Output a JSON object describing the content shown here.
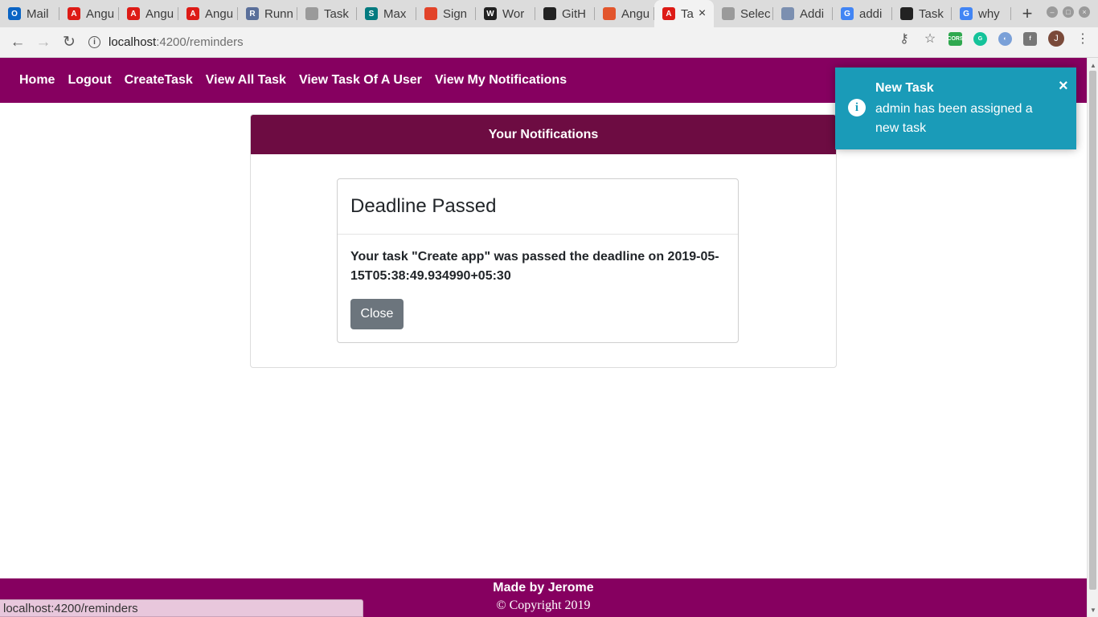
{
  "browser": {
    "tabs": [
      {
        "label": "Mail",
        "icon": "outlook-icon",
        "color": "#0a64c4",
        "glyph": "O"
      },
      {
        "label": "Angu",
        "icon": "angular-icon",
        "color": "#dd1b16",
        "glyph": "A"
      },
      {
        "label": "Angu",
        "icon": "angular-icon",
        "color": "#dd1b16",
        "glyph": "A"
      },
      {
        "label": "Angu",
        "icon": "angular-icon",
        "color": "#dd1b16",
        "glyph": "A"
      },
      {
        "label": "Runn",
        "icon": "runner-icon",
        "color": "#5a6f9a",
        "glyph": "R"
      },
      {
        "label": "Task",
        "icon": "globe-icon",
        "color": "#9a9a9a",
        "glyph": ""
      },
      {
        "label": "Max",
        "icon": "sharepoint-icon",
        "color": "#047b80",
        "glyph": "S"
      },
      {
        "label": "Sign",
        "icon": "gitlab-icon",
        "color": "#e24329",
        "glyph": ""
      },
      {
        "label": "Wor",
        "icon": "wordpress-icon",
        "color": "#222222",
        "glyph": "W"
      },
      {
        "label": "GitH",
        "icon": "github-icon",
        "color": "#222222",
        "glyph": ""
      },
      {
        "label": "Angu",
        "icon": "stackblitz-icon",
        "color": "#e2552c",
        "glyph": ""
      },
      {
        "label": "Ta",
        "icon": "angular-icon",
        "color": "#dd1b16",
        "glyph": "A",
        "active": true
      },
      {
        "label": "Selec",
        "icon": "globe-icon",
        "color": "#9a9a9a",
        "glyph": ""
      },
      {
        "label": "Addi",
        "icon": "image-icon",
        "color": "#7b8fb0",
        "glyph": ""
      },
      {
        "label": "addi",
        "icon": "google-icon",
        "color": "#4285f4",
        "glyph": "G"
      },
      {
        "label": "Task",
        "icon": "github-icon",
        "color": "#222222",
        "glyph": ""
      },
      {
        "label": "why",
        "icon": "google-icon",
        "color": "#4285f4",
        "glyph": "G"
      }
    ],
    "new_tab": "+",
    "url_host": "localhost",
    "url_path": ":4200/reminders",
    "status_url": "localhost:4200/reminders"
  },
  "nav": {
    "items": [
      "Home",
      "Logout",
      "CreateTask",
      "View All Task",
      "View Task Of A User",
      "View My Notifications"
    ],
    "color": "#860060"
  },
  "notifications": {
    "header": "Your Notifications",
    "card": {
      "title": "Deadline Passed",
      "message": "Your task \"Create app\" was passed the deadline on 2019-05-15T05:38:49.934990+05:30",
      "close_label": "Close"
    }
  },
  "toast": {
    "title": "New Task",
    "message": "admin has been assigned a new task",
    "close_glyph": "×",
    "color": "#1a9bb8"
  },
  "footer": {
    "made_by": "Made by Jerome",
    "copyright": "© Copyright 2019"
  }
}
